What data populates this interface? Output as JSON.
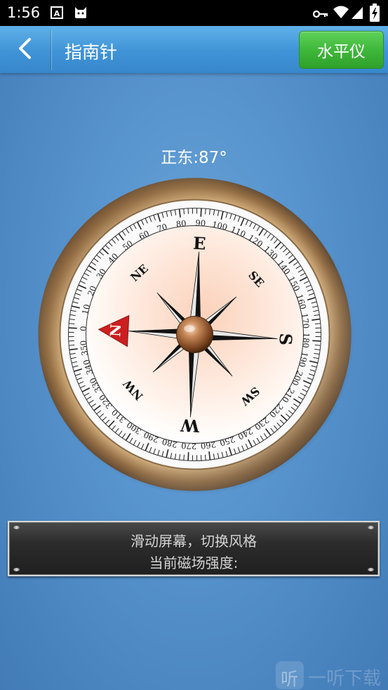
{
  "status_bar": {
    "time": "1:56",
    "icons": [
      "font-a-icon",
      "cat-icon",
      "vpn-key-icon",
      "wifi-icon",
      "signal-icon",
      "battery-charging-icon"
    ]
  },
  "title_bar": {
    "back_icon": "chevron-left-icon",
    "title": "指南针",
    "level_button_label": "水平仪"
  },
  "compass": {
    "heading_label": "正东:87°",
    "heading_degrees": 87,
    "cardinals": {
      "north": "N",
      "east": "E",
      "south": "S",
      "west": "W"
    },
    "intercardinals": {
      "northeast": "NE",
      "southeast": "SE",
      "southwest": "SW",
      "northwest": "NW"
    },
    "degree_labels": [
      "0",
      "10",
      "20",
      "30",
      "40",
      "50",
      "60",
      "70",
      "80",
      "90",
      "100",
      "110",
      "120",
      "130",
      "140",
      "150",
      "160",
      "170",
      "180",
      "190",
      "200",
      "210",
      "220",
      "230",
      "240",
      "250",
      "260",
      "270",
      "280",
      "290",
      "300",
      "310",
      "320",
      "330",
      "340",
      "350"
    ],
    "colors": {
      "needle_red": "#cc1f1f",
      "bezel_dark": "#5a3616",
      "bezel_light": "#d2b27e",
      "face_center": "#fbd6c2"
    }
  },
  "info_panel": {
    "line1": "滑动屏幕，切换风格",
    "line2": "当前磁场强度:"
  },
  "watermark": {
    "box_glyph": "听",
    "text": "一听下载"
  }
}
